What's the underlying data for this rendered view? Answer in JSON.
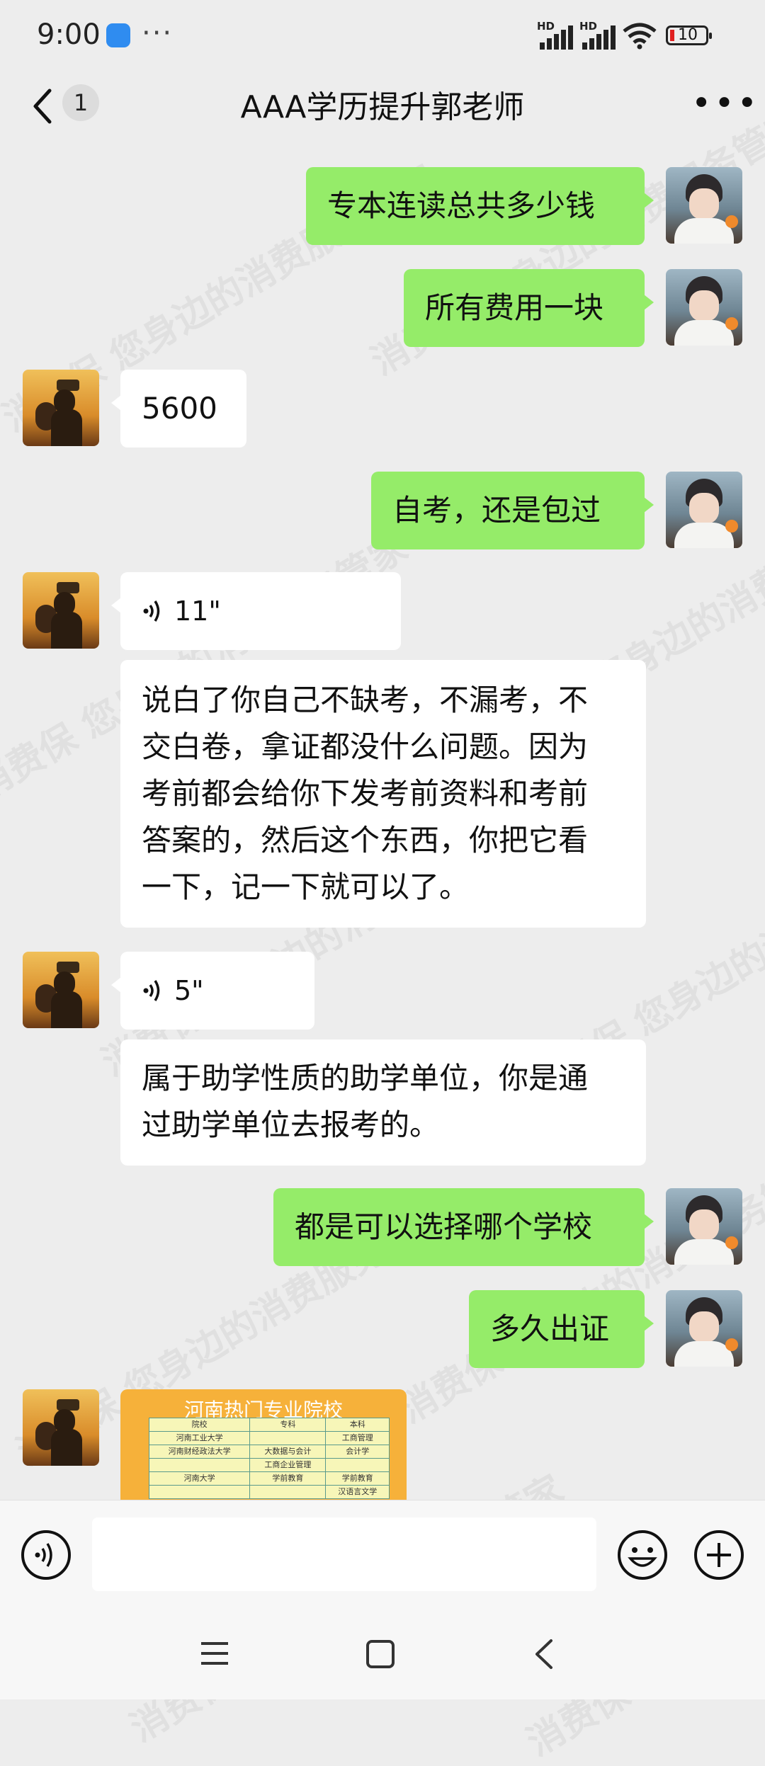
{
  "status_bar": {
    "time": "9:00",
    "battery": "10",
    "hd1": "HD",
    "hd2": "HD"
  },
  "header": {
    "unread_count": "1",
    "title": "AAA学历提升郭老师"
  },
  "messages": [
    {
      "side": "right",
      "text": "专本连读总共多少钱"
    },
    {
      "side": "right",
      "text": "所有费用一块"
    },
    {
      "side": "left",
      "text": "5600"
    },
    {
      "side": "right",
      "text": "自考，还是包过"
    },
    {
      "side": "left",
      "type": "voice",
      "duration": "11\""
    },
    {
      "side": "left",
      "text": "说白了你自己不缺考，不漏考，不交白卷，拿证都没什么问题。因为考前都会给你下发考前资料和考前答案的，然后这个东西，你把它看一下，记一下就可以了。",
      "lines": [
        "说白了你自己不缺考，不漏考，不",
        "交白卷，拿证都没什么问题。因为",
        "考前都会给你下发考前资料和考前",
        "答案的，然后这个东西，你把它看",
        "一下，记一下就可以了。"
      ]
    },
    {
      "side": "left",
      "type": "voice",
      "duration": "5\""
    },
    {
      "side": "left",
      "text": "属于助学性质的助学单位，你是通过助学单位去报考的。",
      "lines": [
        "属于助学性质的助学单位，你是通",
        "过助学单位去报考的。"
      ]
    },
    {
      "side": "right",
      "text": "都是可以选择哪个学校"
    },
    {
      "side": "right",
      "text": "多久出证"
    }
  ],
  "image_message": {
    "title": "河南热门专业院校",
    "headers": [
      "院校",
      "专科",
      "本科"
    ],
    "rows": [
      [
        "河南工业大学",
        "",
        "工商管理"
      ],
      [
        "河南财经政法大学",
        "大数据与会计",
        "会计学"
      ],
      [
        "",
        "工商企业管理",
        ""
      ],
      [
        "河南大学",
        "学前教育",
        "学前教育"
      ],
      [
        "",
        "",
        "汉语言文学"
      ]
    ]
  },
  "watermark": {
    "text": "消费保 您身边的消费服务管家"
  },
  "colors": {
    "background": "#ededed",
    "sent_bubble": "#95ec69",
    "received_bubble": "#ffffff"
  },
  "icons": [
    "back-chevron-icon",
    "more-dots-icon",
    "voice-input-icon",
    "emoji-icon",
    "plus-icon",
    "menu-nav-icon",
    "home-nav-icon",
    "back-nav-icon"
  ]
}
